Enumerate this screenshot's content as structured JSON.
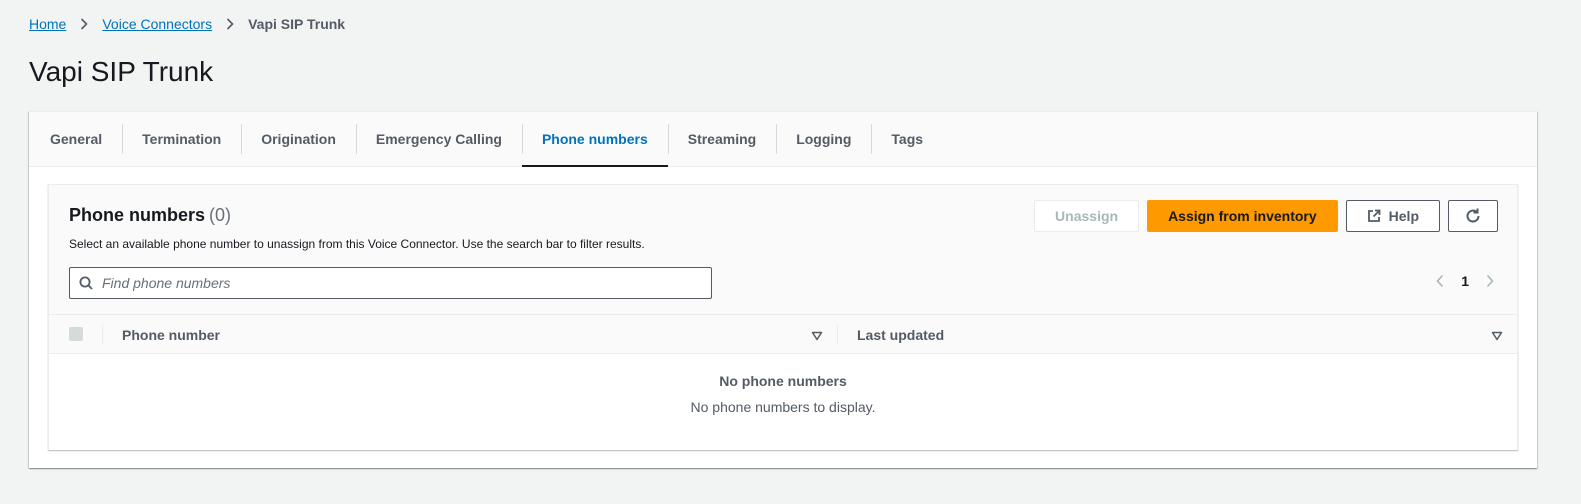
{
  "breadcrumb": {
    "items": [
      {
        "label": "Home"
      },
      {
        "label": "Voice Connectors"
      },
      {
        "label": "Vapi SIP Trunk"
      }
    ]
  },
  "page_title": "Vapi SIP Trunk",
  "tabs": [
    {
      "label": "General",
      "active": false
    },
    {
      "label": "Termination",
      "active": false
    },
    {
      "label": "Origination",
      "active": false
    },
    {
      "label": "Emergency Calling",
      "active": false
    },
    {
      "label": "Phone numbers",
      "active": true
    },
    {
      "label": "Streaming",
      "active": false
    },
    {
      "label": "Logging",
      "active": false
    },
    {
      "label": "Tags",
      "active": false
    }
  ],
  "panel": {
    "title": "Phone numbers",
    "count": "(0)",
    "description": "Select an available phone number to unassign from this Voice Connector. Use the search bar to filter results.",
    "actions": {
      "unassign": "Unassign",
      "assign": "Assign from inventory",
      "help": "Help"
    },
    "search_placeholder": "Find phone numbers",
    "pagination": {
      "current_page": "1"
    },
    "columns": [
      "Phone number",
      "Last updated"
    ],
    "empty": {
      "title": "No phone numbers",
      "message": "No phone numbers to display."
    }
  },
  "colors": {
    "link": "#0073bb",
    "primary_button": "#ff9900",
    "active_tab": "#0073bb"
  }
}
